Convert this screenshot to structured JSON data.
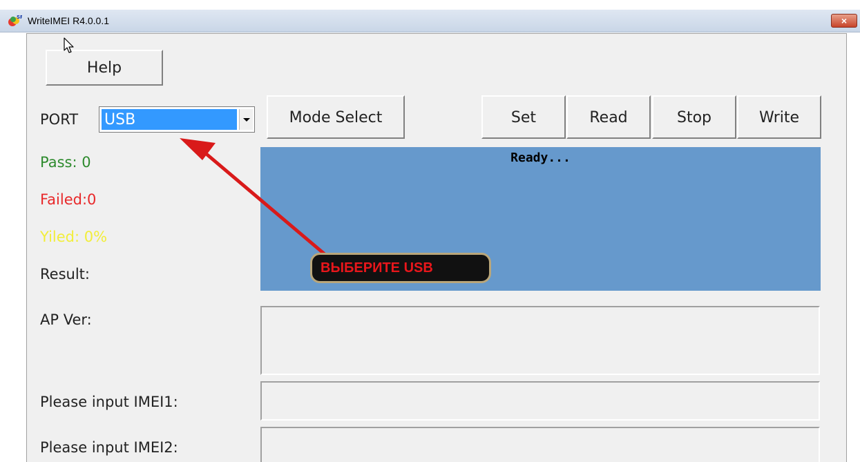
{
  "window": {
    "title": "WriteIMEI R4.0.0.1",
    "close_glyph": "×"
  },
  "toolbar": {
    "help_label": "Help",
    "mode_select_label": "Mode Select",
    "set_label": "Set",
    "read_label": "Read",
    "stop_label": "Stop",
    "write_label": "Write"
  },
  "port": {
    "label": "PORT",
    "selected": "USB"
  },
  "stats": {
    "pass": "Pass:  0",
    "failed": "Failed:0",
    "yield": "Yiled: 0%",
    "result": "Result:"
  },
  "status": {
    "text": "Ready..."
  },
  "fields": {
    "ap_ver_label": "AP Ver:",
    "imei1_label": "Please input IMEI1:",
    "imei2_label": "Please input IMEI2:"
  },
  "annotation": {
    "callout_text": "ВЫБЕРИТЕ USB"
  },
  "colors": {
    "pass": "#2e8b2e",
    "failed": "#e8282a",
    "yield": "#f2ee3a",
    "status_panel": "#6699cc",
    "selection": "#3399ff",
    "arrow": "#d91a1a"
  },
  "icons": {
    "app": "app-logo-icon",
    "cursor": "mouse-cursor-icon"
  }
}
